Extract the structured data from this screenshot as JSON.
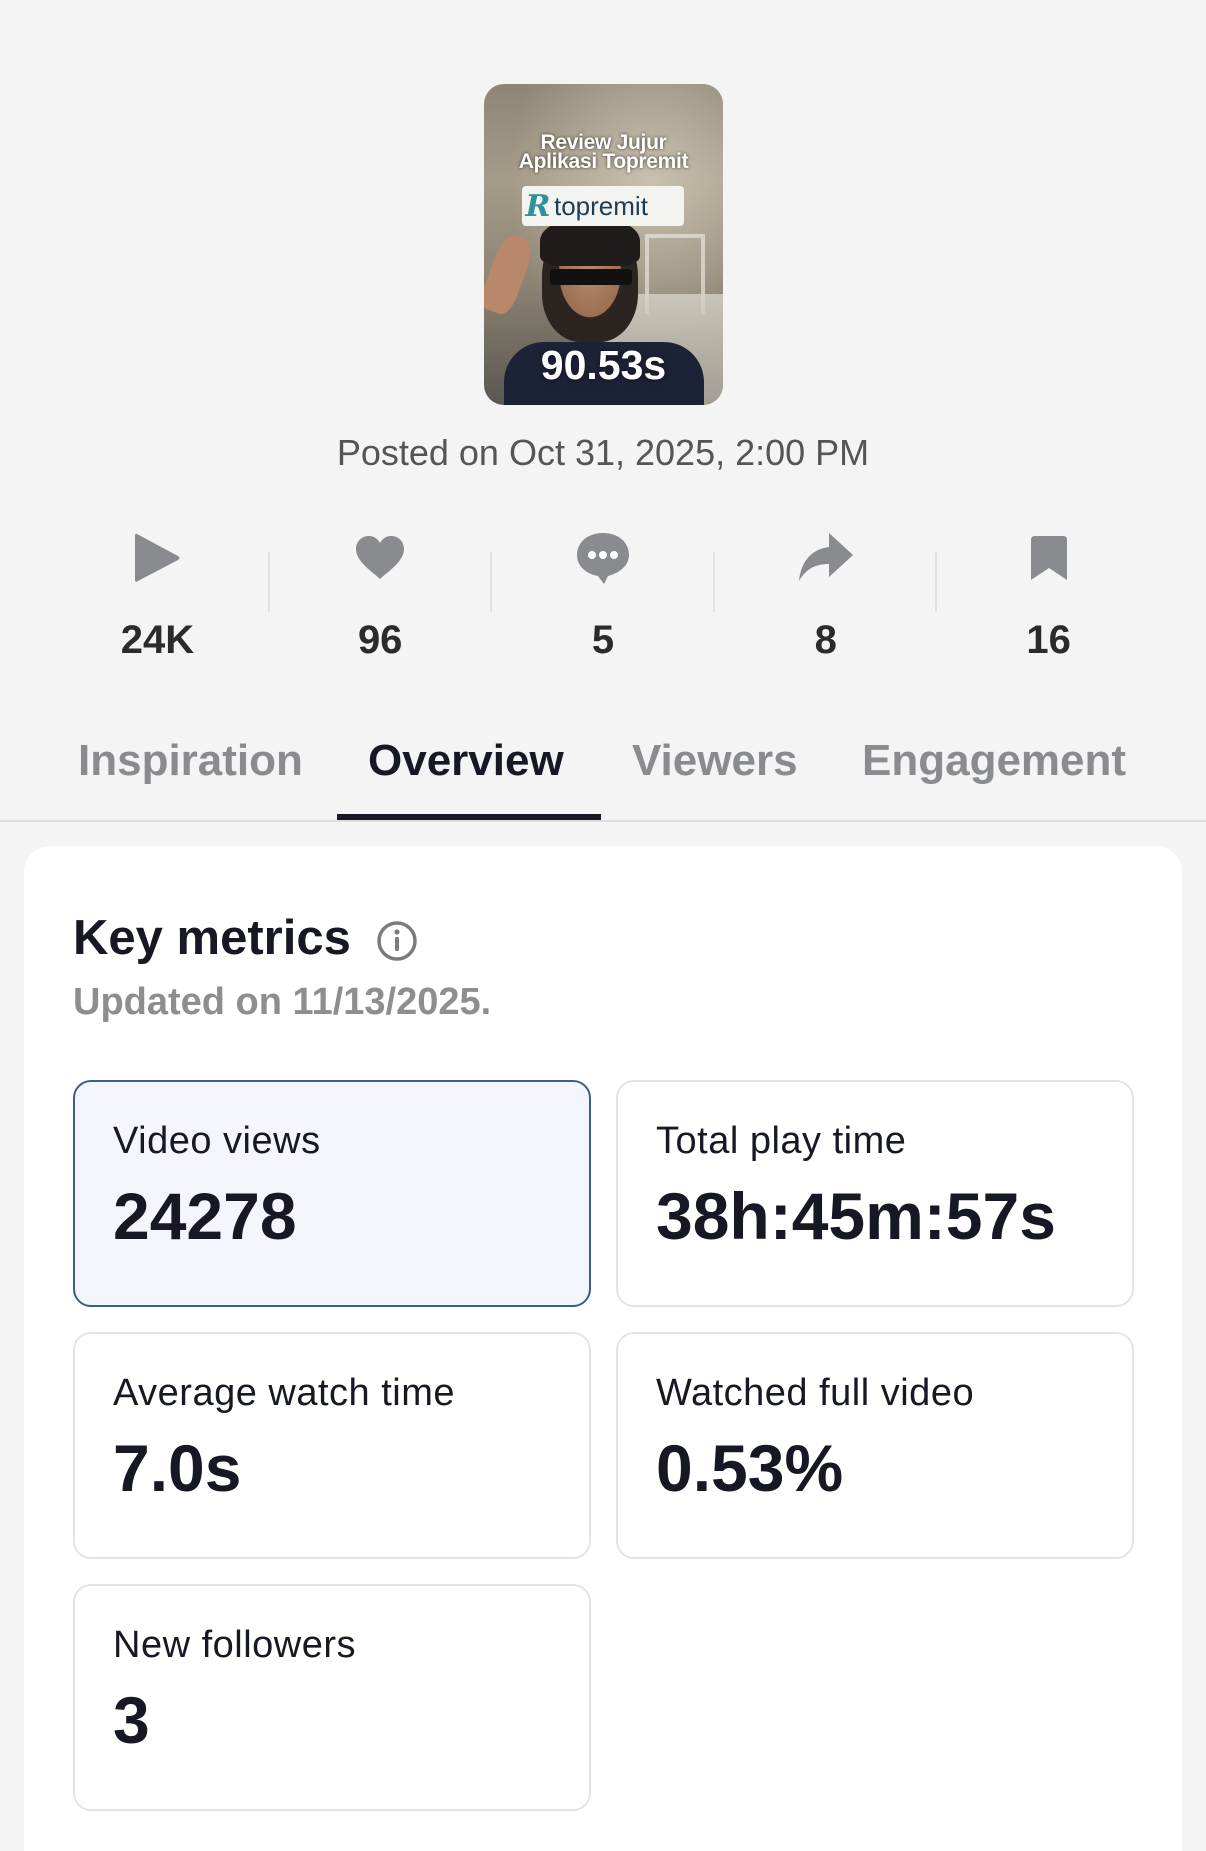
{
  "video": {
    "thumbnail_title_line1": "Review Jujur",
    "thumbnail_title_line2": "Aplikasi Topremit",
    "thumbnail_brand": "topremit",
    "duration": "90.53s",
    "posted": "Posted on Oct 31, 2025, 2:00 PM"
  },
  "stats": [
    {
      "icon": "play-icon",
      "value": "24K"
    },
    {
      "icon": "heart-icon",
      "value": "96"
    },
    {
      "icon": "comment-icon",
      "value": "5"
    },
    {
      "icon": "share-icon",
      "value": "8"
    },
    {
      "icon": "bookmark-icon",
      "value": "16"
    }
  ],
  "tabs": [
    {
      "label": "Inspiration",
      "active": false
    },
    {
      "label": "Overview",
      "active": true
    },
    {
      "label": "Viewers",
      "active": false
    },
    {
      "label": "Engagement",
      "active": false
    }
  ],
  "key_metrics": {
    "title": "Key metrics",
    "updated": "Updated on 11/13/2025.",
    "metrics": [
      {
        "label": "Video views",
        "value": "24278",
        "selected": true
      },
      {
        "label": "Total play time",
        "value": "38h:45m:57s",
        "selected": false
      },
      {
        "label": "Average watch time",
        "value": "7.0s",
        "selected": false
      },
      {
        "label": "Watched full video",
        "value": "0.53%",
        "selected": false
      },
      {
        "label": "New followers",
        "value": "3",
        "selected": false
      }
    ]
  },
  "colors": {
    "background": "#f4f4f4",
    "text": "#161823",
    "muted": "#8a8b8e",
    "selected_border": "#3b5f86",
    "selected_fill": "#f3f7fd",
    "icon_gray": "#8a8b8e"
  }
}
